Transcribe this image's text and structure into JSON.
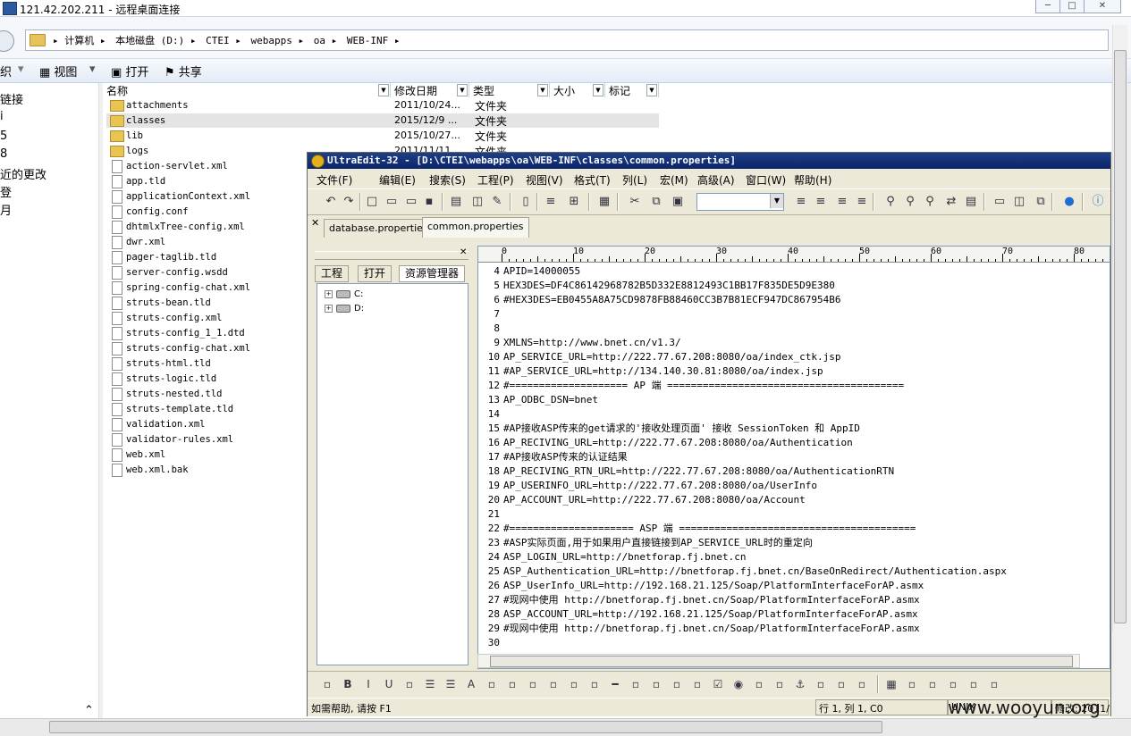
{
  "rdp": {
    "title": "121.42.202.211 - 远程桌面连接",
    "minimize": "─",
    "maximize": "□",
    "close": "✕"
  },
  "explorer": {
    "breadcrumbs": [
      "▸ 计算机 ▸",
      "本地磁盘 (D:) ▸",
      "CTEI ▸",
      "webapps ▸",
      "oa ▸",
      "WEB-INF ▸"
    ],
    "toolbar": {
      "organize": "织",
      "view": "视图",
      "open": "打开",
      "share": "共享"
    },
    "nav": [
      "链接",
      "i",
      "5",
      "8",
      "近的更改",
      "登",
      "月"
    ],
    "columns": {
      "name": "名称",
      "date": "修改日期",
      "type": "类型",
      "size": "大小",
      "tag": "标记"
    },
    "folders": [
      {
        "name": "attachments",
        "date": "2011/10/24...",
        "type": "文件夹"
      },
      {
        "name": "classes",
        "date": "2015/12/9 ...",
        "type": "文件夹"
      },
      {
        "name": "lib",
        "date": "2015/10/27...",
        "type": "文件夹"
      },
      {
        "name": "logs",
        "date": "2011/11/11...",
        "type": "文件夹"
      }
    ],
    "files": [
      "action-servlet.xml",
      "app.tld",
      "applicationContext.xml",
      "config.conf",
      "dhtmlxTree-config.xml",
      "dwr.xml",
      "pager-taglib.tld",
      "server-config.wsdd",
      "spring-config-chat.xml",
      "struts-bean.tld",
      "struts-config.xml",
      "struts-config_1_1.dtd",
      "struts-config-chat.xml",
      "struts-html.tld",
      "struts-logic.tld",
      "struts-nested.tld",
      "struts-template.tld",
      "validation.xml",
      "validator-rules.xml",
      "web.xml",
      "web.xml.bak"
    ]
  },
  "ultraedit": {
    "title": "UltraEdit-32 - [D:\\CTEI\\webapps\\oa\\WEB-INF\\classes\\common.properties]",
    "menu": [
      "文件(F)",
      "编辑(E)",
      "搜索(S)",
      "工程(P)",
      "视图(V)",
      "格式(T)",
      "列(L)",
      "宏(M)",
      "高级(A)",
      "窗口(W)",
      "帮助(H)"
    ],
    "tabs": [
      "database.properties",
      "common.properties"
    ],
    "project_tabs": [
      "工程",
      "打开",
      "资源管理器"
    ],
    "tree": [
      "C:",
      "D:"
    ],
    "ruler": [
      "0",
      "10",
      "20",
      "30",
      "40",
      "50",
      "60",
      "70",
      "80"
    ],
    "lines": [
      {
        "n": "4",
        "t": "APID=14000055"
      },
      {
        "n": "5",
        "t": "HEX3DES=DF4C86142968782B5D332E8812493C1BB17F835DE5D9E380"
      },
      {
        "n": "6",
        "t": "#HEX3DES=EB0455A8A75CD9878FB88460CC3B7B81ECF947DC867954B6"
      },
      {
        "n": "7",
        "t": ""
      },
      {
        "n": "8",
        "t": ""
      },
      {
        "n": "9",
        "t": "XMLNS=http://www.bnet.cn/v1.3/"
      },
      {
        "n": "10",
        "t": "AP_SERVICE_URL=http://222.77.67.208:8080/oa/index_ctk.jsp"
      },
      {
        "n": "11",
        "t": "#AP_SERVICE_URL=http://134.140.30.81:8080/oa/index.jsp"
      },
      {
        "n": "12",
        "t": "#==================== AP 端 ========================================"
      },
      {
        "n": "13",
        "t": "AP_ODBC_DSN=bnet"
      },
      {
        "n": "14",
        "t": ""
      },
      {
        "n": "15",
        "t": "#AP接收ASP传来的get请求的'接收处理页面' 接收 SessionToken 和 AppID"
      },
      {
        "n": "16",
        "t": "AP_RECIVING_URL=http://222.77.67.208:8080/oa/Authentication"
      },
      {
        "n": "17",
        "t": "#AP接收ASP传来的认证结果"
      },
      {
        "n": "18",
        "t": "AP_RECIVING_RTN_URL=http://222.77.67.208:8080/oa/AuthenticationRTN"
      },
      {
        "n": "19",
        "t": "AP_USERINFO_URL=http://222.77.67.208:8080/oa/UserInfo"
      },
      {
        "n": "20",
        "t": "AP_ACCOUNT_URL=http://222.77.67.208:8080/oa/Account"
      },
      {
        "n": "21",
        "t": ""
      },
      {
        "n": "22",
        "t": "#===================== ASP 端 ========================================"
      },
      {
        "n": "23",
        "t": "#ASP实际页面,用于如果用户直接链接到AP_SERVICE_URL时的重定向"
      },
      {
        "n": "24",
        "t": "ASP_LOGIN_URL=http://bnetforap.fj.bnet.cn"
      },
      {
        "n": "25",
        "t": "ASP_Authentication_URL=http://bnetforap.fj.bnet.cn/BaseOnRedirect/Authentication.aspx"
      },
      {
        "n": "26",
        "t": "ASP_UserInfo_URL=http://192.168.21.125/Soap/PlatformInterfaceForAP.asmx"
      },
      {
        "n": "27",
        "t": "#现网中使用 http://bnetforap.fj.bnet.cn/Soap/PlatformInterfaceForAP.asmx"
      },
      {
        "n": "28",
        "t": "ASP_ACCOUNT_URL=http://192.168.21.125/Soap/PlatformInterfaceForAP.asmx"
      },
      {
        "n": "29",
        "t": "#现网中使用 http://bnetforap.fj.bnet.cn/Soap/PlatformInterfaceForAP.asmx"
      },
      {
        "n": "30",
        "t": ""
      }
    ],
    "status": {
      "help": "如需帮助, 请按 F1",
      "pos": "行 1, 列 1, C0",
      "mode": "UNIX",
      "modified": "修改: 2011/"
    }
  },
  "watermark": "www.wooyun.org"
}
